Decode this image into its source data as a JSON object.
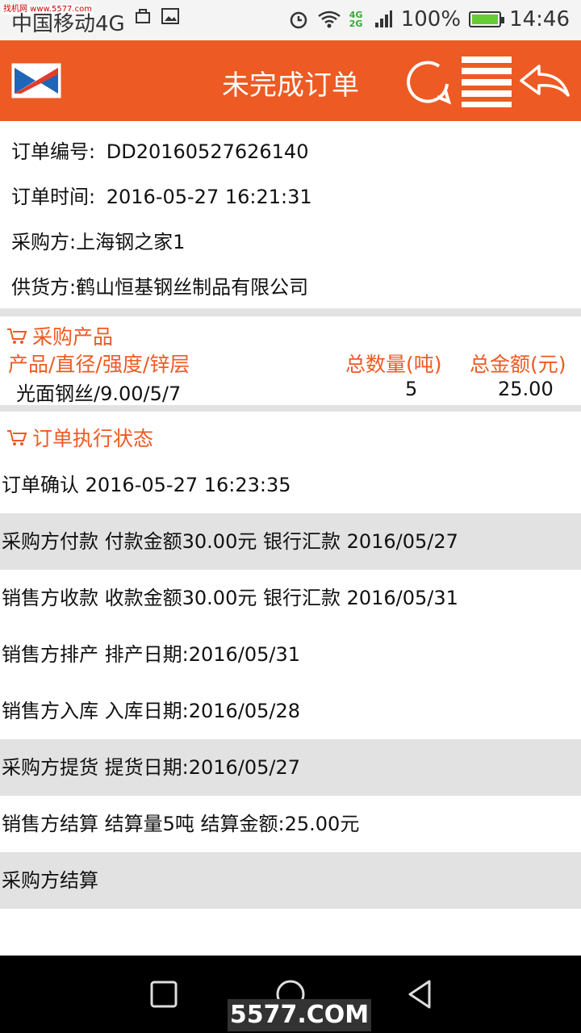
{
  "status_bar": {
    "watermark": "找机网 www.5577.com",
    "carrier": "中国移动4G",
    "network_badge": "4G 2G",
    "battery": "100%",
    "time": "14:46"
  },
  "header": {
    "title": "未完成订单"
  },
  "order": {
    "number_label": "订单编号:",
    "number": "DD20160527626140",
    "time_label": "订单时间:",
    "time": "2016-05-27 16:21:31",
    "buyer": "采购方:上海钢之家1",
    "supplier": "供货方:鹤山恒基钢丝制品有限公司"
  },
  "products": {
    "section_title": "采购产品",
    "columns": [
      "产品/直径/强度/锌层",
      "总数量(吨)",
      "总金额(元)"
    ],
    "rows": [
      {
        "product": "光面钢丝/9.00/5/7",
        "quantity": "5",
        "amount": "25.00"
      }
    ]
  },
  "execution": {
    "section_title": "订单执行状态",
    "items": [
      "订单确认 2016-05-27 16:23:35",
      "采购方付款 付款金额30.00元 银行汇款 2016/05/27",
      "销售方收款 收款金额30.00元 银行汇款 2016/05/31",
      "销售方排产 排产日期:2016/05/31",
      "销售方入库 入库日期:2016/05/28",
      "采购方提货 提货日期:2016/05/27",
      "销售方结算 结算量5吨 结算金额:25.00元",
      "采购方结算"
    ]
  },
  "watermark_bottom": "5577.COM",
  "colors": {
    "accent": "#ee5a24",
    "divider": "#e2e2e2",
    "navbar": "#000000"
  }
}
